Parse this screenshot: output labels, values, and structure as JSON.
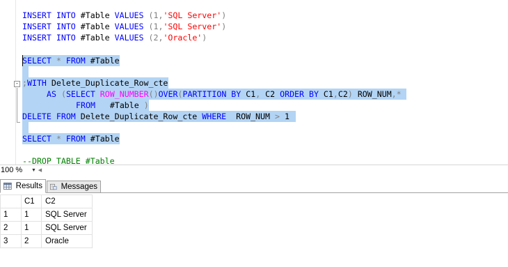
{
  "editor": {
    "lines": {
      "l1": {
        "kw1": "INSERT INTO",
        "rest1": " #Table ",
        "kw2": "VALUES",
        "rest2": " (1,",
        "str": "'SQL Server'",
        "end": ")"
      },
      "l2": {
        "kw1": "INSERT INTO",
        "rest1": " #Table ",
        "kw2": "VALUES",
        "rest2": " (1,",
        "str": "'SQL Server'",
        "end": ")"
      },
      "l3": {
        "kw1": "INSERT INTO",
        "rest1": " #Table ",
        "kw2": "VALUES",
        "rest2": " (2,",
        "str": "'Oracle'",
        "end": ")"
      },
      "l4": {
        "kw1": "SELECT",
        "op": " * ",
        "kw2": "FROM",
        "rest": " #Table"
      },
      "l5": {
        "op": ";",
        "kw": "WITH",
        "rest": " Delete_Duplicate_Row_cte"
      },
      "l6": {
        "kw1": "AS",
        "op1": " (",
        "kw2": "SELECT",
        "fn": " ROW_NUMBER",
        "op2": "()",
        "kw3": "OVER",
        "op3": "(",
        "kw4": "PARTITION BY",
        "rest1": " C1",
        "op4": ",",
        "rest2": " C2 ",
        "kw5": "ORDER BY",
        "rest3": " C1",
        "op5": ",",
        "rest4": "C2",
        "op6": ")",
        "rest5": " ROW_NUM",
        "op7": ",*"
      },
      "l7": {
        "kw": "FROM",
        "rest": "   #Table ",
        "op": ")"
      },
      "l8": {
        "kw1": "DELETE FROM",
        "rest1": " Delete_Duplicate_Row_cte ",
        "kw2": "WHERE",
        "rest2": "  ROW_NUM ",
        "op": ">",
        "rest3": " 1"
      },
      "l9": {
        "kw1": "SELECT",
        "op": " * ",
        "kw2": "FROM",
        "rest": " #Table"
      },
      "l10": {
        "comment": "--DROP TABLE #Table"
      }
    },
    "collapse_glyph": "-"
  },
  "status": {
    "zoom": "100 %",
    "zoom_dropdown_icon": "triangle-down",
    "scroll_left_icon": "triangle-left"
  },
  "tabs": {
    "results_label": "Results",
    "messages_label": "Messages",
    "results_icon": "grid-icon",
    "messages_icon": "messages-icon"
  },
  "grid": {
    "headers": {
      "c1": "C1",
      "c2": "C2"
    },
    "rows": [
      {
        "num": "1",
        "c1": "1",
        "c2": "SQL Server"
      },
      {
        "num": "2",
        "c1": "1",
        "c2": "SQL Server"
      },
      {
        "num": "3",
        "c1": "2",
        "c2": "Oracle"
      }
    ]
  },
  "colors": {
    "keyword": "#0000ff",
    "string": "#ff0000",
    "operator": "#808080",
    "function": "#ff00ff",
    "comment": "#008000",
    "selection": "#b3d4f4"
  }
}
